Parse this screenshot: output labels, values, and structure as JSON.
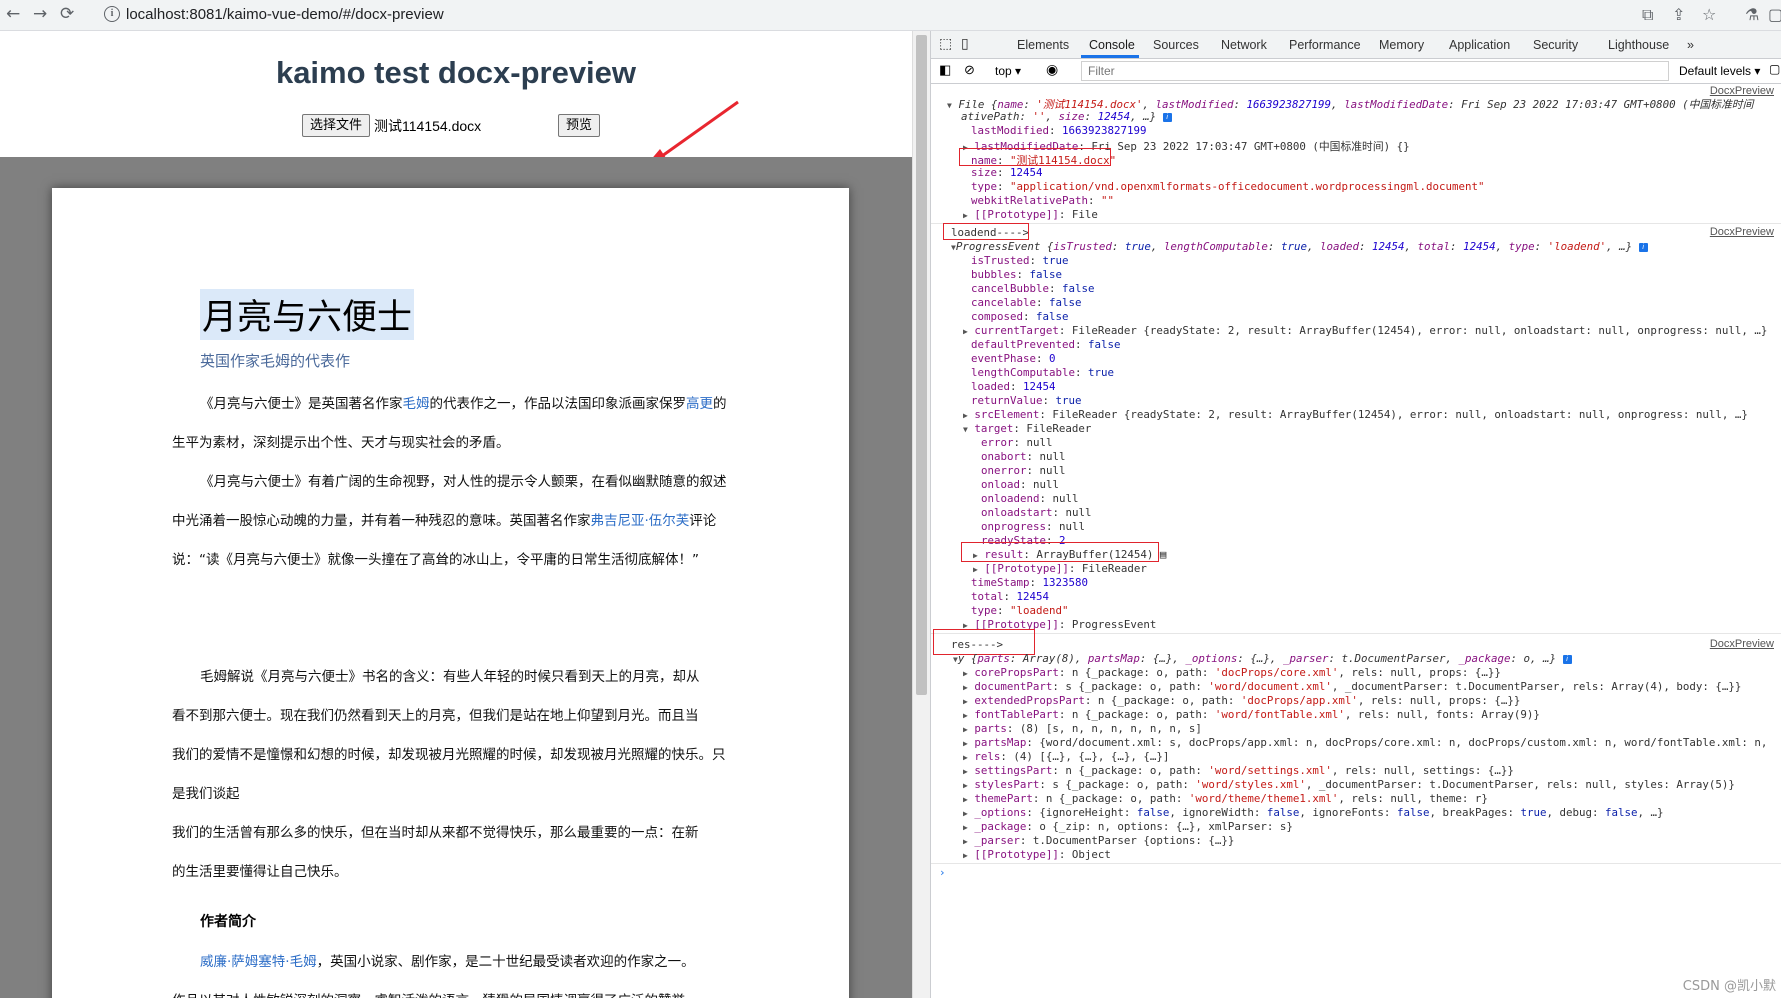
{
  "browser": {
    "url": "localhost:8081/kaimo-vue-demo/#/docx-preview",
    "back": "←",
    "forward": "→",
    "reload": "⟳"
  },
  "page": {
    "title": "kaimo test docx-preview",
    "choose_file_label": "选择文件",
    "file_name": "测试114154.docx",
    "preview_label": "预览"
  },
  "doc": {
    "title": "月亮与六便士",
    "subtitle": "英国作家毛姆的代表作",
    "p1": [
      "《月亮与六便士》是英国著名作家",
      "毛姆",
      "的代表作之一，作品以法国印象派画家保罗",
      "高更",
      "的生平为素材，深刻提示出个性、天才与现实社会的矛盾。"
    ],
    "p2": [
      "《月亮与六便士》有着广阔的生命视野，对人性的提示令人颤栗，在看似幽默随意的叙述中光涌着一股惊心动魄的力量，并有着一种残忍的意味。英国著名作家",
      "弗吉尼亚·伍尔芙",
      "评论说：“读《月亮与六便士》就像一头撞在了高耸的冰山上，令平庸的日常生活彻底解体！”"
    ],
    "p3": "毛姆解说《月亮与六便士》书名的含义：有些人年轻的时候只看到天上的月亮，却从看不到那六便士。现在我们仍然看到天上的月亮，但我们是站在地上仰望到月光。而且当我们的爱情不是憧憬和幻想的时候，却发现被月光照耀的快乐，那么最重要的一点：在新的生活里要懂得让自己快乐。",
    "p3_lines": [
      "毛姆解说《月亮与六便士》书名的含义：有些人年轻的时候只看到天上的月亮，却从",
      "看不到那六便士。现在我们仍然看到天上的月亮，但我们是站在地上仰望到月光。而且当",
      "我们的爱情不是憧憬和幻想的时候，却发现被月光照耀的时候，却发现被月光照耀的快乐。只是我们谈起",
      "我们的生活曾有那么多的快乐，但在当时却从来都不觉得快乐，那么最重要的一点：在新",
      "的生活里要懂得让自己快乐。"
    ],
    "heading": "作者简介",
    "p4": [
      "威廉·萨姆塞特·毛姆",
      "，英国小说家、剧作家，是二十世纪最受读者欢迎的作家之一。"
    ],
    "p4_line2": "作品以其对人性敏锐深刻的洞察、睿智活泼的语言，猜猾的异国情调赢得了广泛的赞誉"
  },
  "devtools": {
    "tabs": [
      "Elements",
      "Console",
      "Sources",
      "Network",
      "Performance",
      "Memory",
      "Application",
      "Security",
      "Lighthouse"
    ],
    "active_tab": "Console",
    "context": "top",
    "filter_placeholder": "Filter",
    "levels": "Default levels",
    "source": "DocxPreview",
    "watermark": "CSDN @凯小默"
  }
}
